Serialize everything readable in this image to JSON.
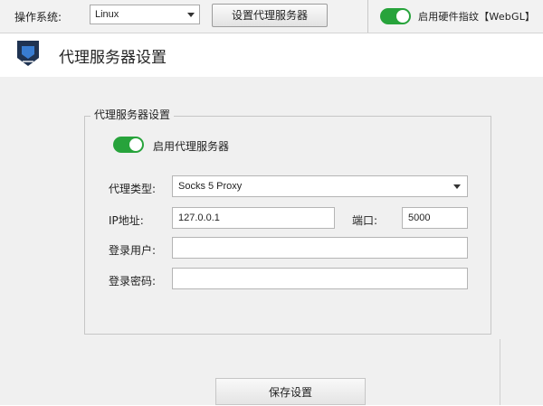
{
  "topbar": {
    "os_label": "操作系统:",
    "os_value": "Linux",
    "proxy_button": "设置代理服务器",
    "hw_fingerprint_label": "启用硬件指纹【WebGL】"
  },
  "header": {
    "title": "代理服务器设置"
  },
  "proxy_group": {
    "legend": "代理服务器设置",
    "enable_label": "启用代理服务器",
    "type_label": "代理类型:",
    "type_value": "Socks 5 Proxy",
    "ip_label": "IP地址:",
    "ip_value": "127.0.0.1",
    "port_label": "端口:",
    "port_value": "5000",
    "user_label": "登录用户:",
    "user_value": "",
    "password_label": "登录密码:",
    "password_value": ""
  },
  "footer": {
    "save_button": "保存设置"
  },
  "colors": {
    "toggle_on": "#27a33b",
    "logo_bg": "#1f3352",
    "logo_accent": "#3d8ae8"
  }
}
